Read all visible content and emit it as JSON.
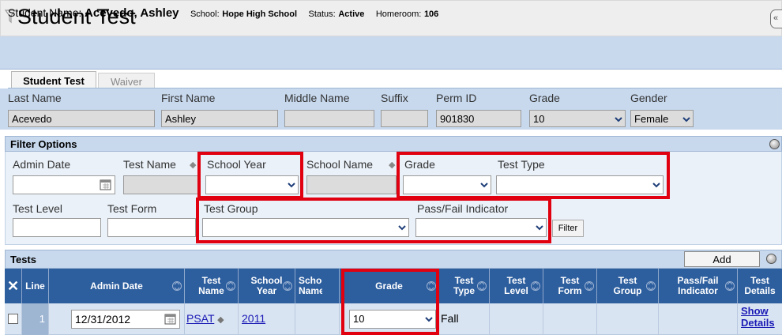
{
  "window": {
    "title": "Student Test"
  },
  "student_info": {
    "name_label": "Student Name:",
    "name": "Acevedo, Ashley",
    "school_label": "School:",
    "school": "Hope High School",
    "status_label": "Status:",
    "status": "Active",
    "homeroom_label": "Homeroom:",
    "homeroom": "106"
  },
  "tabs": [
    {
      "label": "Student Test",
      "active": true
    },
    {
      "label": "Waiver",
      "active": false
    }
  ],
  "student_fields": {
    "last_name": {
      "label": "Last Name",
      "value": "Acevedo"
    },
    "first_name": {
      "label": "First Name",
      "value": "Ashley"
    },
    "middle_name": {
      "label": "Middle Name",
      "value": ""
    },
    "suffix": {
      "label": "Suffix",
      "value": ""
    },
    "perm_id": {
      "label": "Perm ID",
      "value": "901830"
    },
    "grade": {
      "label": "Grade",
      "value": "10"
    },
    "gender": {
      "label": "Gender",
      "value": "Female"
    }
  },
  "filter": {
    "header": "Filter Options",
    "admin_date": "Admin Date",
    "test_name": "Test Name",
    "school_year": "School Year",
    "school_name": "School Name",
    "grade": "Grade",
    "test_type": "Test Type",
    "test_level": "Test Level",
    "test_form": "Test Form",
    "test_group": "Test Group",
    "pass_fail": "Pass/Fail Indicator",
    "filter_button": "Filter"
  },
  "tests": {
    "header": "Tests",
    "add_button": "Add",
    "columns": {
      "line": "Line",
      "admin_date": "Admin Date",
      "test_name": "Test Name",
      "school_year": "School Year",
      "school_name": "School Name",
      "grade": "Grade",
      "test_type": "Test Type",
      "test_level": "Test Level",
      "test_form": "Test Form",
      "test_group": "Test Group",
      "pass_fail": "Pass/Fail Indicator",
      "test_details": "Test Details"
    },
    "rows": [
      {
        "line": "1",
        "admin_date": "12/31/2012",
        "test_name": "PSAT",
        "school_year": "2011",
        "grade": "10",
        "test_type": "Fall",
        "details_link": "Show Details"
      }
    ]
  },
  "colors": {
    "highlight": "#e0000f",
    "grid_header": "#2d5e9e",
    "panel": "#c8d9ee"
  }
}
